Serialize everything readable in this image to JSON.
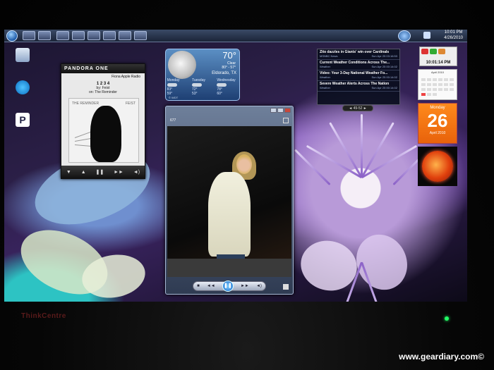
{
  "taskbar": {
    "clock_time": "10:01 PM",
    "clock_date": "4/26/2010"
  },
  "pandora": {
    "logo": "PANDORA ONE",
    "station": "Fiona Apple Radio",
    "song": "1 2 3 4",
    "artist_line": "by: Feist",
    "album_line": "on: The Reminder",
    "cover_left": "THE REMINDER",
    "cover_right": "FEIST"
  },
  "weather": {
    "temperature": "70°",
    "condition": "Clear",
    "hi_lo": "80° - 57°",
    "city": "Eldorado, TX",
    "days": [
      {
        "name": "Monday",
        "hi": "83°",
        "lo": "59°"
      },
      {
        "name": "Tuesday",
        "hi": "72°",
        "lo": "53°"
      },
      {
        "name": "Wednesday",
        "hi": "78°",
        "lo": "60°"
      }
    ],
    "source": "© WDT"
  },
  "news": {
    "items": [
      {
        "title": "Zito dazzles in Giants' win over Cardinals",
        "source": "MSNBC News",
        "time": "Sun Apr 25 03:16:53"
      },
      {
        "title": "Current Weather Conditions Across The...",
        "source": "Weather",
        "time": "Sun Apr 25 00:14:02"
      },
      {
        "title": "Video: Your 3-Day National Weather Fo...",
        "source": "Weather",
        "time": "Sun Apr 25 00:14:02"
      },
      {
        "title": "Severe Weather Alerts Across The Nation",
        "source": "Weather",
        "time": "Sun Apr 25 00:14:02"
      }
    ],
    "pager": "49-52"
  },
  "clock_gadget": {
    "time": "10:01:14 PM"
  },
  "mini_calendar": {
    "month": "April 2010"
  },
  "day_calendar": {
    "weekday": "Monday",
    "day": "26",
    "month_year": "April 2010"
  },
  "viewer": {
    "counter": "677"
  },
  "bezel": {
    "brand": "ThinkCentre"
  },
  "watermark": "www.geardiary.com©"
}
